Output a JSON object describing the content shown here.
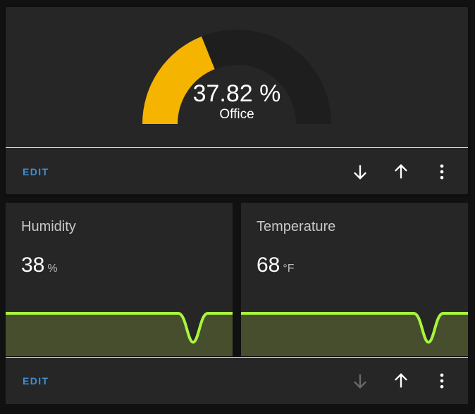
{
  "gauge_card": {
    "value_text": "37.82 %",
    "entity_name": "Office",
    "value_percent": 37.82,
    "fill_color": "#f5b400",
    "track_color": "#1e1e1e",
    "edit_label": "EDIT",
    "icons": [
      "arrow-down-icon",
      "arrow-up-icon",
      "more-vert-icon"
    ]
  },
  "sensor_card": {
    "sensors": [
      {
        "name": "Humidity",
        "value": "38",
        "unit": "%"
      },
      {
        "name": "Temperature",
        "value": "68",
        "unit": "°F"
      }
    ],
    "line_color": "#a8f53c",
    "fill_color": "#464e2e",
    "edit_label": "EDIT",
    "move_down_disabled": true,
    "icons": [
      "arrow-down-icon",
      "arrow-up-icon",
      "more-vert-icon"
    ]
  }
}
